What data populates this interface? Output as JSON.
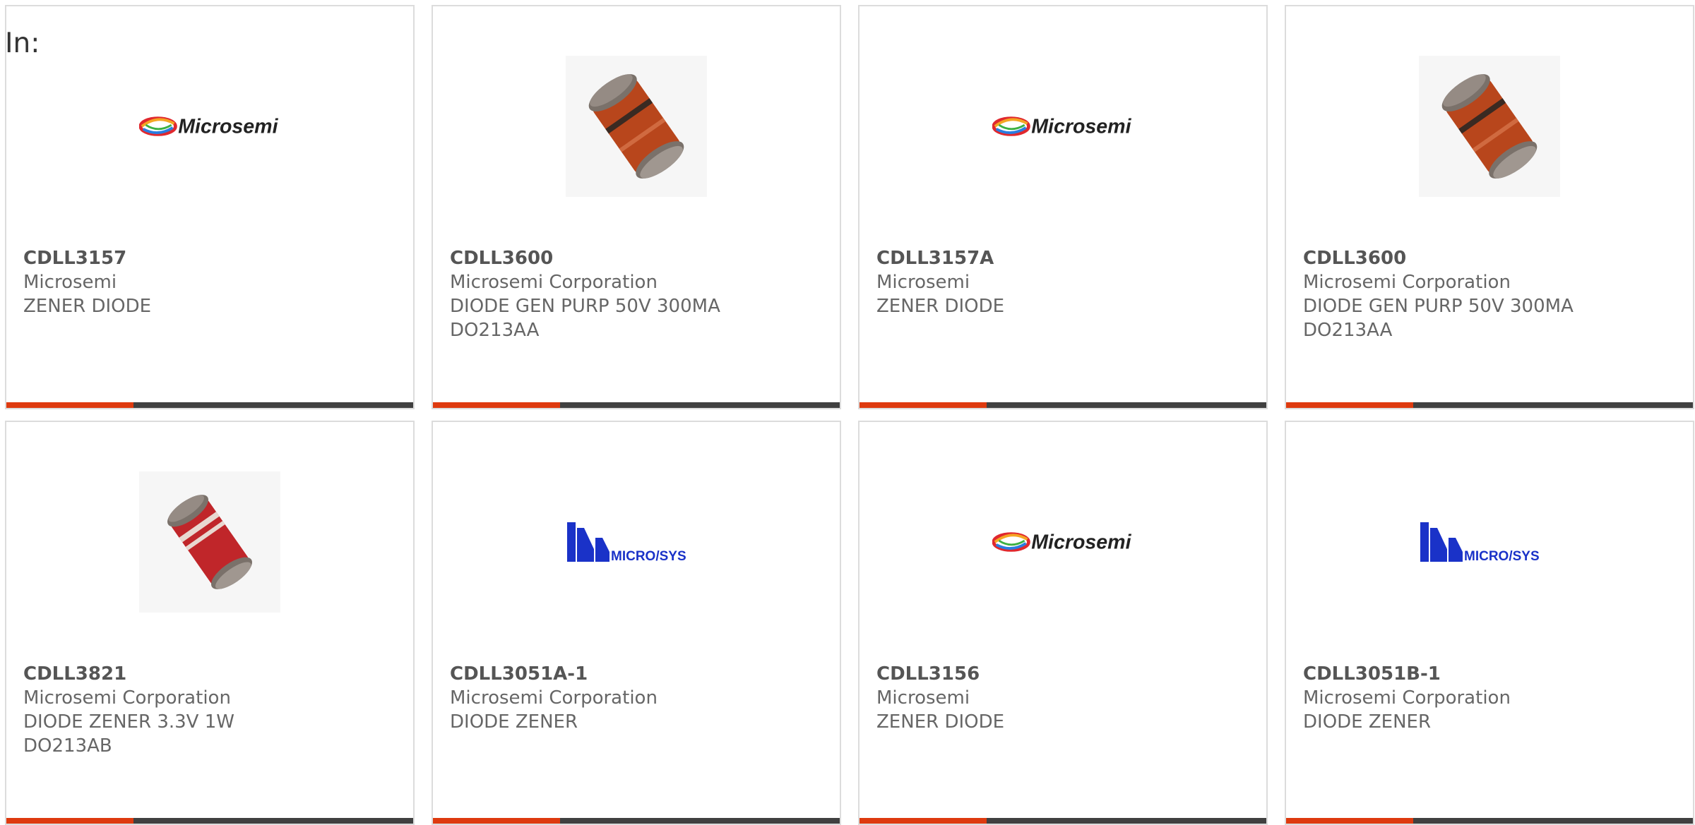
{
  "header": {
    "in_label": "In:"
  },
  "brand_colors": {
    "accent": "#de3a0f",
    "bar": "#404040",
    "microsys_blue": "#1a32c8"
  },
  "products": [
    {
      "part_number": "CDLL3157",
      "manufacturer": "Microsemi",
      "description": "ZENER DIODE",
      "image": "microsemi-logo"
    },
    {
      "part_number": "CDLL3600",
      "manufacturer": "Microsemi Corporation",
      "description": "DIODE GEN PURP 50V 300MA DO213AA",
      "image": "diode-photo"
    },
    {
      "part_number": "CDLL3157A",
      "manufacturer": "Microsemi",
      "description": "ZENER DIODE",
      "image": "microsemi-logo"
    },
    {
      "part_number": "CDLL3600",
      "manufacturer": "Microsemi Corporation",
      "description": "DIODE GEN PURP 50V 300MA DO213AA",
      "image": "diode-photo"
    },
    {
      "part_number": "CDLL3821",
      "manufacturer": "Microsemi Corporation",
      "description": "DIODE ZENER 3.3V 1W DO213AB",
      "image": "diode-photo-red"
    },
    {
      "part_number": "CDLL3051A-1",
      "manufacturer": "Microsemi Corporation",
      "description": "DIODE ZENER",
      "image": "microsys-logo"
    },
    {
      "part_number": "CDLL3156",
      "manufacturer": "Microsemi",
      "description": "ZENER DIODE",
      "image": "microsemi-logo"
    },
    {
      "part_number": "CDLL3051B-1",
      "manufacturer": "Microsemi Corporation",
      "description": "DIODE ZENER",
      "image": "microsys-logo"
    }
  ],
  "logos": {
    "microsemi_text": "Microsemi",
    "microsys_text": "MICRO/SYS"
  }
}
